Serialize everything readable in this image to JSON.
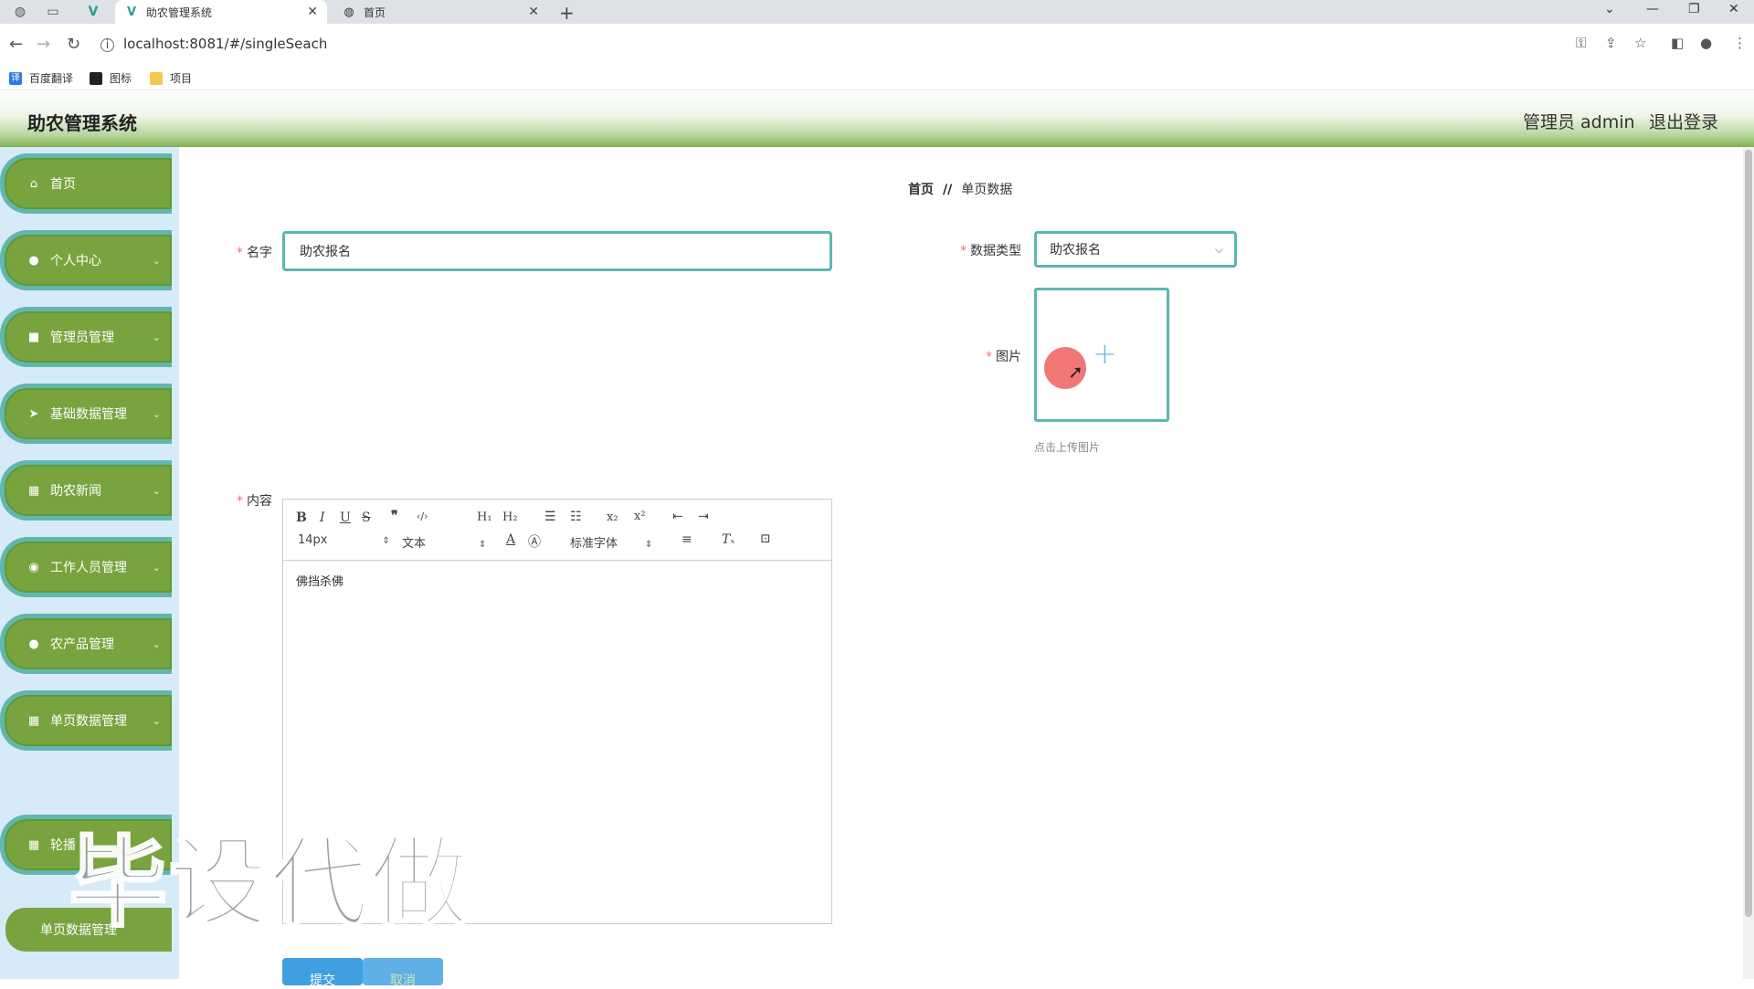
{
  "browser": {
    "tabs": [
      {
        "title": "助农管理系统",
        "active": true
      },
      {
        "title": "首页",
        "active": false
      }
    ],
    "url": "localhost:8081/#/singleSeach",
    "bookmarks": [
      "百度翻译",
      "图标",
      "项目"
    ]
  },
  "header": {
    "title": "助农管理系统",
    "user": "管理员 admin",
    "logout": "退出登录"
  },
  "sidebar": {
    "items": [
      {
        "label": "首页",
        "icon": "home-icon",
        "expandable": false
      },
      {
        "label": "个人中心",
        "icon": "user-icon",
        "expandable": true
      },
      {
        "label": "管理员管理",
        "icon": "video-icon",
        "expandable": true
      },
      {
        "label": "基础数据管理",
        "icon": "send-icon",
        "expandable": true
      },
      {
        "label": "助农新闻",
        "icon": "grid-icon",
        "expandable": true
      },
      {
        "label": "工作人员管理",
        "icon": "location-icon",
        "expandable": true
      },
      {
        "label": "农产品管理",
        "icon": "user-icon",
        "expandable": true
      },
      {
        "label": "单页数据管理",
        "icon": "grid-icon",
        "expandable": true
      },
      {
        "label": "轮播",
        "icon": "grid-icon",
        "expandable": true
      }
    ],
    "active_subitem": "单页数据管理"
  },
  "breadcrumb": {
    "home": "首页",
    "separator": "//",
    "current": "单页数据"
  },
  "form": {
    "name_label": "名字",
    "name_value": "助农报名",
    "type_label": "数据类型",
    "type_value": "助农报名",
    "image_label": "图片",
    "upload_tip": "点击上传图片",
    "content_label": "内容",
    "content_value": "佛挡杀佛",
    "toolbar": {
      "font_size": "14px",
      "header": "文本",
      "font_family": "标准字体"
    },
    "submit_label": "提交",
    "cancel_label": "取消"
  },
  "watermark": "毕设代做",
  "colors": {
    "menu_bg": "#78a33e",
    "menu_border": "#62b6b0",
    "input_border": "#5bb7b0",
    "sidebar_bg": "#d6ebf7",
    "required": "#f56c6c"
  }
}
